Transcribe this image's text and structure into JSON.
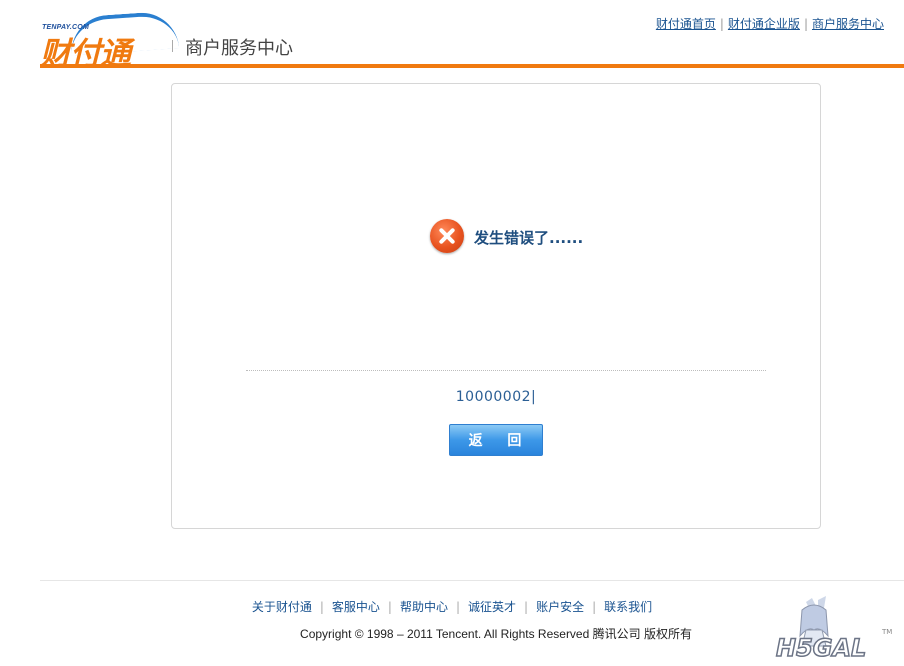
{
  "header": {
    "logo_small": "TENPAY.COM",
    "logo_name": "财付通",
    "title": "商户服务中心",
    "links": [
      "财付通首页",
      "财付通企业版",
      "商户服务中心"
    ]
  },
  "main": {
    "error_message": "发生错误了......",
    "error_code": "10000002|",
    "back_label": "返 回"
  },
  "footer": {
    "links": [
      "关于财付通",
      "客服中心",
      "帮助中心",
      "诚征英才",
      "账户安全",
      "联系我们"
    ],
    "copyright": "Copyright © 1998 – 2011 Tencent. All Rights Reserved 腾讯公司 版权所有",
    "watermark_text": "H5GAL",
    "watermark_mark": "TM"
  },
  "colors": {
    "brand_orange": "#f07a10",
    "link_blue": "#1a5390",
    "error_red": "#e85320",
    "button_blue": "#3d98e8"
  }
}
